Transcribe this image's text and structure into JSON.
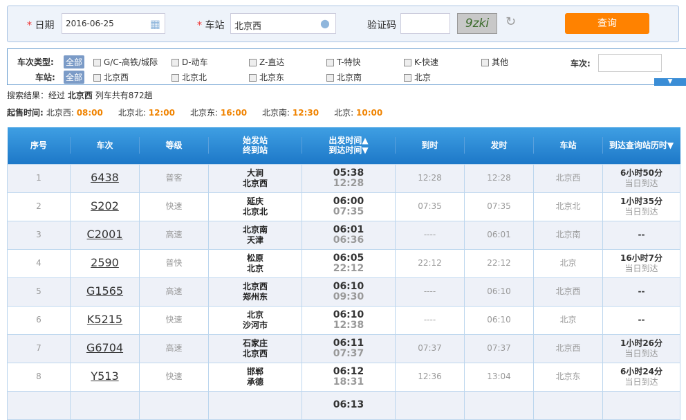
{
  "search": {
    "date_label": "日期",
    "date_value": "2016-06-25",
    "station_label": "车站",
    "station_value": "北京西",
    "captcha_label": "验证码",
    "captcha_text": "9zki",
    "query_button": "查询",
    "required_mark": "*"
  },
  "filter": {
    "type_label": "车次类型:",
    "station_label": "车站:",
    "all_label": "全部",
    "types": [
      "G/C-高铁/城际",
      "D-动车",
      "Z-直达",
      "T-特快",
      "K-快速",
      "其他"
    ],
    "stations": [
      "北京西",
      "北京北",
      "北京东",
      "北京南",
      "北京"
    ],
    "train_no_label": "车次:",
    "train_no_value": ""
  },
  "result": {
    "prefix": "搜索结果：经过",
    "station": "北京西",
    "suffix": "列车共有872趟"
  },
  "sale": {
    "label": "起售时间:",
    "items": [
      {
        "station": "北京西:",
        "time": "08:00"
      },
      {
        "station": "北京北:",
        "time": "12:00"
      },
      {
        "station": "北京东:",
        "time": "16:00"
      },
      {
        "station": "北京南:",
        "time": "12:30"
      },
      {
        "station": "北京:",
        "time": "10:00"
      }
    ]
  },
  "table": {
    "headers": [
      "序号",
      "车次",
      "等级",
      "始发站\n终到站",
      "出发时间▲\n到达时间▼",
      "到时",
      "发时",
      "车站",
      "到达查询站历时▼"
    ],
    "rows": [
      [
        "1",
        "6438",
        "普客",
        "大涧",
        "北京西",
        "05:38",
        "12:28",
        "12:28",
        "12:28",
        "北京西",
        "6小时50分",
        "当日到达"
      ],
      [
        "2",
        "S202",
        "快速",
        "延庆",
        "北京北",
        "06:00",
        "07:35",
        "07:35",
        "07:35",
        "北京北",
        "1小时35分",
        "当日到达"
      ],
      [
        "3",
        "C2001",
        "高速",
        "北京南",
        "天津",
        "06:01",
        "06:36",
        "----",
        "06:01",
        "北京南",
        "--",
        ""
      ],
      [
        "4",
        "2590",
        "普快",
        "松原",
        "北京",
        "06:05",
        "22:12",
        "22:12",
        "22:12",
        "北京",
        "16小时7分",
        "当日到达"
      ],
      [
        "5",
        "G1565",
        "高速",
        "北京西",
        "郑州东",
        "06:10",
        "09:30",
        "----",
        "06:10",
        "北京西",
        "--",
        ""
      ],
      [
        "6",
        "K5215",
        "快速",
        "北京",
        "沙河市",
        "06:10",
        "12:38",
        "----",
        "06:10",
        "北京",
        "--",
        ""
      ],
      [
        "7",
        "G6704",
        "高速",
        "石家庄",
        "北京西",
        "06:11",
        "07:37",
        "07:37",
        "07:37",
        "北京西",
        "1小时26分",
        "当日到达"
      ],
      [
        "8",
        "Y513",
        "快速",
        "邯郸",
        "承德",
        "06:12",
        "18:31",
        "12:36",
        "13:04",
        "北京东",
        "6小时24分",
        "当日到达"
      ],
      [
        "",
        "",
        "",
        "",
        "",
        "06:13",
        "",
        "",
        "",
        "",
        "",
        ""
      ]
    ]
  }
}
